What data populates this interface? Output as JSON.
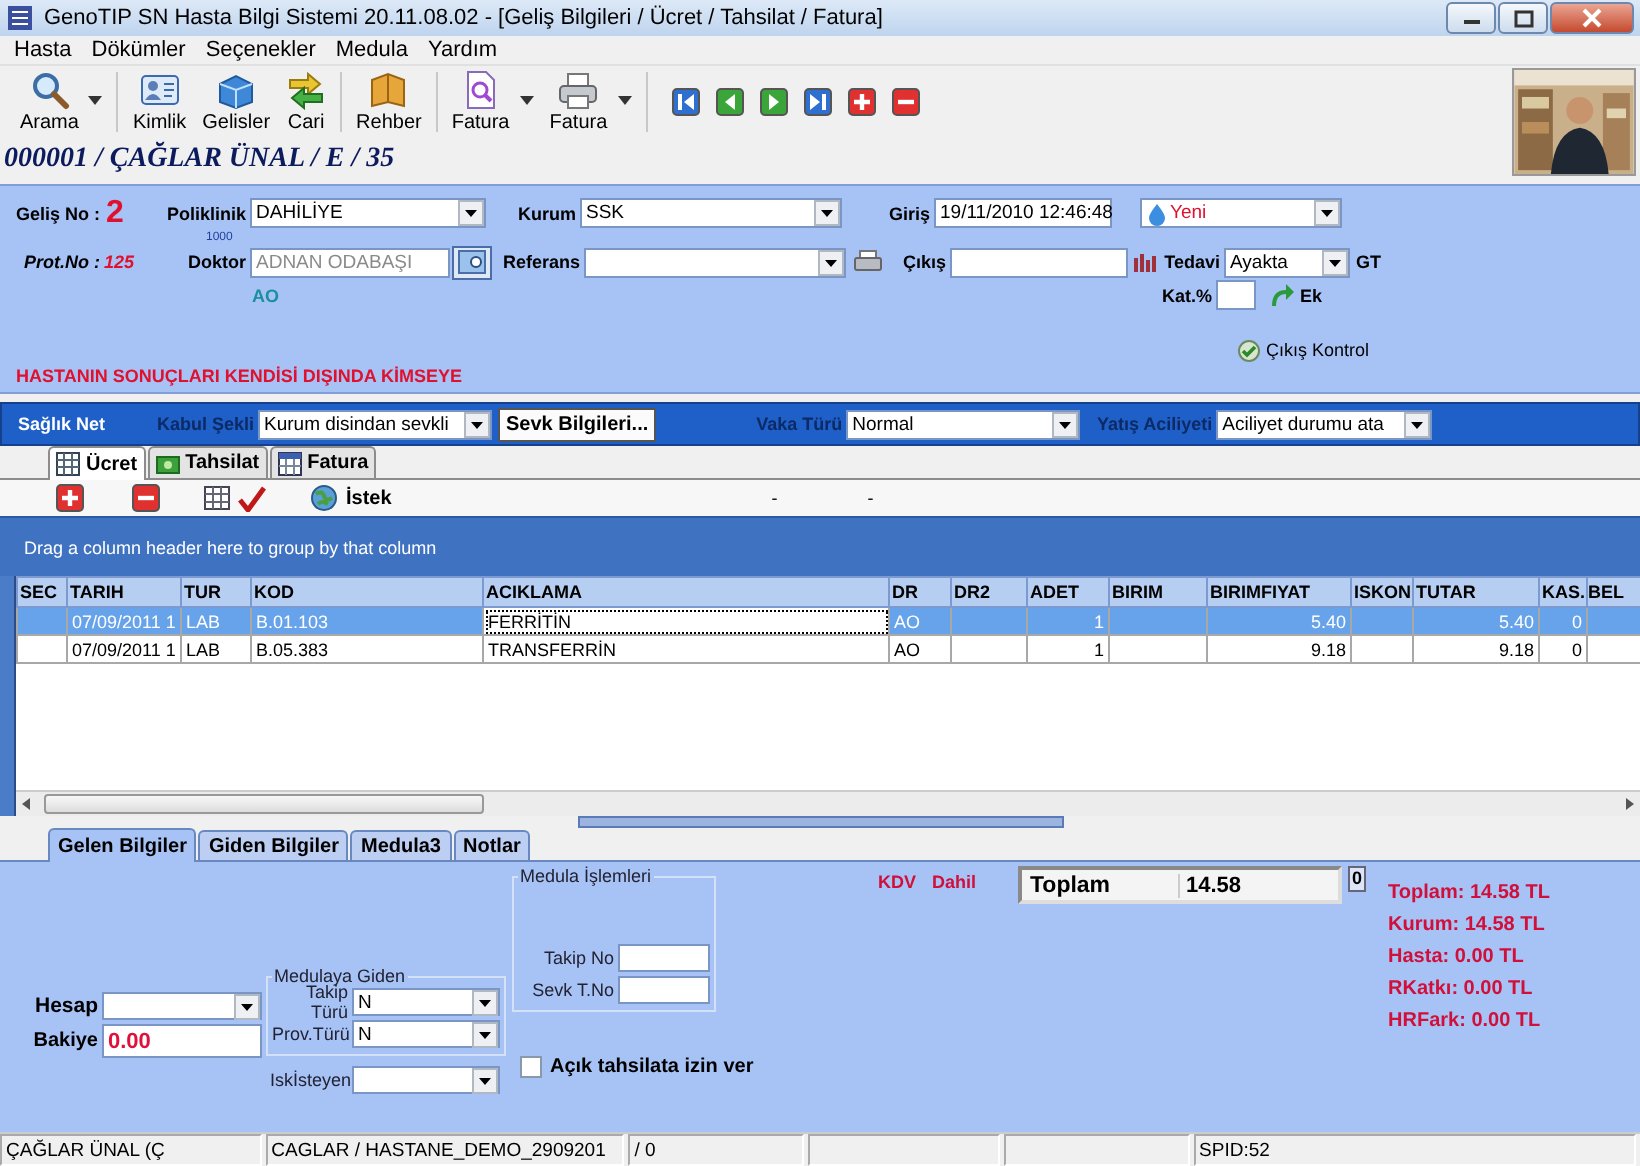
{
  "window": {
    "title": "GenoTIP SN Hasta Bilgi Sistemi  20.11.08.02 - [Geliş Bilgileri / Ücret / Tahsilat / Fatura]"
  },
  "menu": [
    "Hasta",
    "Dökümler",
    "Seçenekler",
    "Medula",
    "Yardım"
  ],
  "toolbar": {
    "groups": [
      {
        "buttons": [
          {
            "label": "Arama",
            "kind": "search",
            "dropdown": true
          }
        ]
      },
      {
        "buttons": [
          {
            "label": "Kimlik",
            "kind": "card",
            "dropdown": false
          },
          {
            "label": "Gelisler",
            "kind": "box",
            "dropdown": false
          },
          {
            "label": "Cari",
            "kind": "exchange",
            "dropdown": false
          }
        ]
      },
      {
        "buttons": [
          {
            "label": "Rehber",
            "kind": "book",
            "dropdown": false
          }
        ]
      },
      {
        "buttons": [
          {
            "label": "Fatura",
            "kind": "document",
            "dropdown": true
          },
          {
            "label": "Fatura",
            "kind": "printer",
            "dropdown": true
          }
        ]
      }
    ],
    "nav_buttons": [
      {
        "kind": "first"
      },
      {
        "kind": "prev"
      },
      {
        "kind": "next"
      },
      {
        "kind": "last"
      },
      {
        "kind": "add"
      },
      {
        "kind": "remove"
      }
    ]
  },
  "patient": "000001 / ÇAĞLAR ÜNAL / E / 35",
  "photo": {
    "kind": "picture"
  },
  "visit": {
    "gelis_no": {
      "label": "Geliş No :",
      "value": "2"
    },
    "prot_no": {
      "label": "Prot.No :",
      "value": "125"
    },
    "poliklinik": {
      "label": "Poliklinik",
      "value": "DAHİLİYE"
    },
    "doktor": {
      "label": "Doktor",
      "code": "1000",
      "value": "ADNAN ODABAŞI",
      "disabled": true,
      "initials": "AO"
    },
    "kurum": {
      "label": "Kurum",
      "value": "SSK"
    },
    "referans": {
      "label": "Referans"
    },
    "giris": {
      "label": "Giriş",
      "value": "19/11/2010 12:46:48"
    },
    "cikis": {
      "label": "Çıkış"
    },
    "durum": {
      "value": "Yeni"
    },
    "tedavi": {
      "label": "Tedavi",
      "value": "Ayakta",
      "suffix": "GT"
    },
    "kat": {
      "label": "Kat.%"
    },
    "ek": {
      "label": "Ek"
    },
    "cikis_kontrol": {
      "label": "Çıkış Kontrol"
    },
    "warning": "HASTANIN SONUÇLARI KENDİSİ DIŞINDA KİMSEYE"
  },
  "saglik_net": {
    "title": "Sağlık Net",
    "kabul_sekli": {
      "label": "Kabul Şekli",
      "value": "Kurum disindan sevkli"
    },
    "sevk_button": "Sevk Bilgileri...",
    "vaka_turu": {
      "label": "Vaka Türü",
      "value": "Normal"
    },
    "yatis_aciliyeti": {
      "label": "Yatış Aciliyeti",
      "value": "Aciliyet durumu ata"
    }
  },
  "tabs": [
    {
      "label": "Ücret",
      "kind": "grid",
      "selected": true
    },
    {
      "label": "Tahsilat",
      "kind": "money",
      "selected": false
    },
    {
      "label": "Fatura",
      "kind": "calendar",
      "selected": false
    }
  ],
  "grid_tools": {
    "buttons": [
      {
        "kind": "add"
      },
      {
        "kind": "remove"
      },
      {
        "kind": "grid"
      },
      {
        "kind": "check"
      }
    ],
    "istek": "İstek",
    "dashes": [
      "-",
      "-"
    ]
  },
  "group_panel": "Drag a column header here to group by that column",
  "table": {
    "columns": [
      {
        "label": "SEC",
        "kind": "text"
      },
      {
        "label": "TARIH",
        "kind": "text"
      },
      {
        "label": "TUR",
        "kind": "text"
      },
      {
        "label": "KOD",
        "kind": "text"
      },
      {
        "label": "ACIKLAMA",
        "kind": "text"
      },
      {
        "label": "DR",
        "kind": "text"
      },
      {
        "label": "DR2",
        "kind": "text"
      },
      {
        "label": "ADET",
        "kind": "number"
      },
      {
        "label": "BIRIM",
        "kind": "text"
      },
      {
        "label": "BIRIMFIYAT",
        "kind": "number"
      },
      {
        "label": "ISKON",
        "kind": "number"
      },
      {
        "label": "TUTAR",
        "kind": "number"
      },
      {
        "label": "KAS.",
        "kind": "number"
      },
      {
        "label": "BEL",
        "kind": "text"
      }
    ],
    "rows": [
      {
        "selected": true,
        "cells": [
          null,
          {
            "text": "07/09/2011 1",
            "focused": false
          },
          {
            "text": "LAB",
            "focused": false
          },
          {
            "text": "B.01.103",
            "focused": false
          },
          {
            "text": "FERRİTİN",
            "focused": true
          },
          {
            "text": "AO",
            "focused": false
          },
          null,
          {
            "text": "1",
            "focused": false
          },
          null,
          {
            "text": "5.40",
            "focused": false
          },
          null,
          {
            "text": "5.40",
            "focused": false
          },
          {
            "text": "0",
            "focused": false
          },
          null
        ]
      },
      {
        "selected": false,
        "cells": [
          null,
          {
            "text": "07/09/2011 1",
            "focused": false
          },
          {
            "text": "LAB",
            "focused": false
          },
          {
            "text": "B.05.383",
            "focused": false
          },
          {
            "text": "TRANSFERRİN",
            "focused": false
          },
          {
            "text": "AO",
            "focused": false
          },
          null,
          {
            "text": "1",
            "focused": false
          },
          null,
          {
            "text": "9.18",
            "focused": false
          },
          null,
          {
            "text": "9.18",
            "focused": false
          },
          {
            "text": "0",
            "focused": false
          },
          null
        ]
      }
    ]
  },
  "bottom": {
    "tabs": [
      {
        "label": "Gelen Bilgiler",
        "selected": true
      },
      {
        "label": "Giden Bilgiler",
        "selected": false
      },
      {
        "label": "Medula3",
        "selected": false
      },
      {
        "label": "Notlar",
        "selected": false
      }
    ],
    "hesap": {
      "label": "Hesap"
    },
    "bakiye": {
      "label": "Bakiye",
      "value": "0.00"
    },
    "medulaya_giden": {
      "title": "Medulaya Giden",
      "takip_turu": {
        "label": "Takip Türü",
        "value": "N"
      },
      "prov_turu": {
        "label": "Prov.Türü",
        "value": "N"
      }
    },
    "isk_isteyen": {
      "label": "Iskİsteyen"
    },
    "medula_islemleri": {
      "title": "Medula İşlemleri",
      "takip_no": {
        "label": "Takip No"
      },
      "sevk_t_no": {
        "label": "Sevk T.No"
      }
    },
    "acik_tahsilat": {
      "label": "Açık tahsilata izin ver",
      "checked": false
    },
    "kdv": [
      "KDV",
      "Dahil"
    ],
    "toplam": {
      "label": "Toplam",
      "value": "14.58",
      "count": "0"
    },
    "totals": [
      "Toplam: 14.58 TL",
      "Kurum: 14.58 TL",
      "Hasta: 0.00 TL",
      "RKatkı: 0.00 TL",
      "HRFark: 0.00 TL"
    ]
  },
  "status_bar": [
    {
      "kind": "text",
      "text": "ÇAĞLAR ÜNAL (Ç"
    },
    {
      "kind": "text",
      "text": "CAGLAR / HASTANE_DEMO_2909201"
    },
    {
      "kind": "text",
      "text": "/ 0"
    },
    {
      "kind": "empty"
    },
    {
      "kind": "empty"
    },
    {
      "kind": "text",
      "text": "SPID:52"
    }
  ]
}
